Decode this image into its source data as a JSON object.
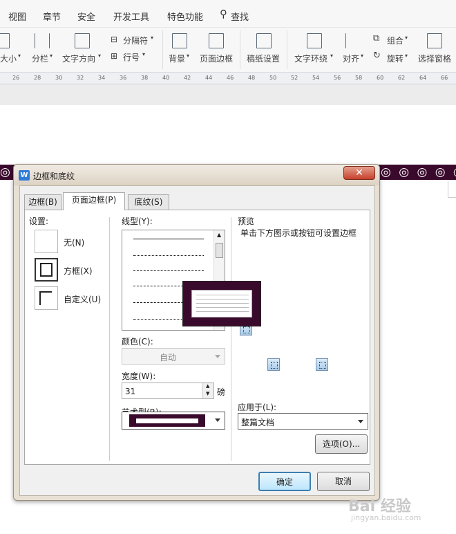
{
  "menubar": {
    "items": [
      "视图",
      "章节",
      "安全",
      "开发工具",
      "特色功能",
      "查找"
    ]
  },
  "ribbon": {
    "labels": [
      "大小",
      "分栏",
      "文字方向",
      "分隔符",
      "行号",
      "背景",
      "页面边框",
      "稿纸设置",
      "文字环绕",
      "对齐",
      "组合",
      "旋转",
      "选择窗格"
    ]
  },
  "ruler": {
    "ticks": [
      "26",
      "28",
      "30",
      "32",
      "34",
      "36",
      "38",
      "40",
      "42",
      "44",
      "46",
      "48",
      "50",
      "52",
      "54",
      "56",
      "58",
      "60",
      "62",
      "64",
      "66"
    ]
  },
  "deco": {
    "pattern": "◎ ◎ ◎ ◎ ◎ ◎ ◎ ◎ ◎ ◎ ◎ ◎ ◎ ◎ ◎ ◎ ◎ ◎ ◎ ◎ ◎ ◎ ◎ ◎ ◎ ◎ ◎"
  },
  "dialog": {
    "title": "边框和底纹",
    "close": "✕",
    "tabs": [
      "边框(B)",
      "页面边框(P)",
      "底纹(S)"
    ],
    "settings_label": "设置:",
    "settings": [
      "无(N)",
      "方框(X)",
      "自定义(U)"
    ],
    "line_style_label": "线型(Y):",
    "color_label": "颜色(C):",
    "color_value": "自动",
    "width_label": "宽度(W):",
    "width_value": "31",
    "width_unit": "磅",
    "art_label": "艺术型(R):",
    "preview_label": "预览",
    "preview_hint": "单击下方图示或按钮可设置边框",
    "apply_label": "应用于(L):",
    "apply_value": "整篇文档",
    "options_button": "选项(O)...",
    "ok_button": "确定",
    "cancel_button": "取消"
  },
  "watermark": {
    "brand": "Bai 经验",
    "url": "jingyan.baidu.com"
  }
}
